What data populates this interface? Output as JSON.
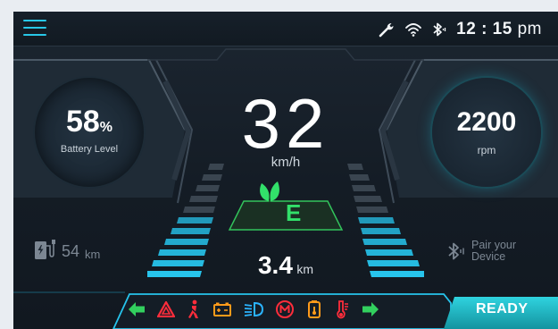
{
  "status_bar": {
    "time": "12 : 15",
    "time_suffix": "pm",
    "icons": [
      "wrench-icon",
      "wifi-icon",
      "bluetooth-icon"
    ]
  },
  "battery": {
    "value": "58",
    "unit": "%",
    "label": "Battery Level"
  },
  "rpm": {
    "value": "2200",
    "label": "rpm"
  },
  "speed": {
    "value": "32",
    "unit": "km/h"
  },
  "drive_mode": {
    "letter": "E",
    "icon": "eco-leaf-icon"
  },
  "trip": {
    "value": "3.4",
    "unit": "km"
  },
  "range": {
    "value": "54",
    "unit": "km",
    "icon": "charging-station-icon"
  },
  "bluetooth_pair": {
    "line1": "Pair your",
    "line2": "Device"
  },
  "indicators": [
    "left-turn-signal-icon",
    "hazard-warning-icon",
    "seatbelt-warning-icon",
    "battery-warning-icon",
    "low-beam-headlight-icon",
    "motor-warning-icon",
    "coolant-temp-icon",
    "temperature-warning-icon",
    "right-turn-signal-icon"
  ],
  "ready": {
    "label": "READY"
  },
  "colors": {
    "accent_cyan": "#28c7e8",
    "eco_green": "#32e06a",
    "warning_red": "#ff2d3b",
    "warning_orange": "#ff9b1a",
    "indicator_blue": "#2bb4ff"
  }
}
